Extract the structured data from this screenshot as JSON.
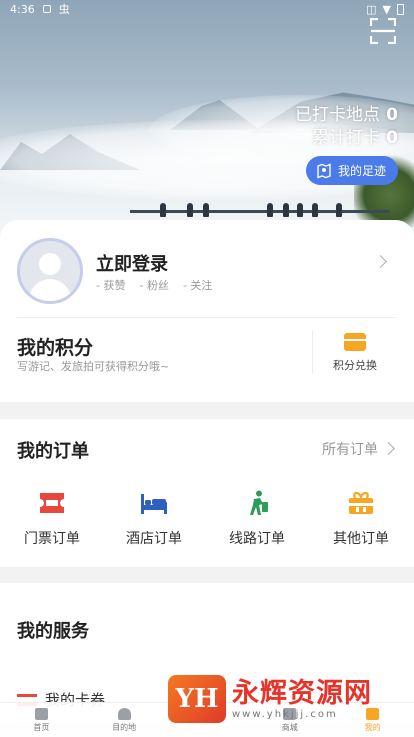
{
  "status_bar": {
    "time": "4:36",
    "notif_a": "A",
    "notif_b": "虫"
  },
  "header": {
    "checkin_places_label": "已打卡地点",
    "checkin_places_count": "0",
    "total_checkins_label": "累计打卡",
    "total_checkins_count": "0",
    "footprint_button": "我的足迹"
  },
  "profile": {
    "login_title": "立即登录",
    "likes": "获赞",
    "fans": "粉丝",
    "follow": "关注"
  },
  "points": {
    "title": "我的积分",
    "subtitle": "写游记、发旅拍可获得积分哦~",
    "exchange_label": "积分兑换"
  },
  "orders": {
    "title": "我的订单",
    "all_label": "所有订单",
    "items": [
      {
        "label": "门票订单",
        "icon": "ticket-icon"
      },
      {
        "label": "酒店订单",
        "icon": "bed-icon"
      },
      {
        "label": "线路订单",
        "icon": "traveler-icon"
      },
      {
        "label": "其他订单",
        "icon": "gift-icon"
      }
    ]
  },
  "services": {
    "title": "我的服务",
    "voucher_label": "我的卡券"
  },
  "watermark": {
    "logo": "YH",
    "name": "永辉资源网",
    "url": "www.yhkjjj.com"
  },
  "tabbar": {
    "items": [
      {
        "label": "首页",
        "icon": "home-icon"
      },
      {
        "label": "目的地",
        "icon": "destination-icon"
      },
      {
        "label": "",
        "icon": "center-icon"
      },
      {
        "label": "商城",
        "icon": "shop-icon"
      },
      {
        "label": "我的",
        "icon": "profile-icon"
      }
    ],
    "active_index": 4
  },
  "colors": {
    "accent_blue": "#4a7be8",
    "accent_orange": "#f6a623",
    "accent_red": "#e8473b",
    "accent_green": "#2a9d5b",
    "accent_navy": "#2f5fbf"
  }
}
